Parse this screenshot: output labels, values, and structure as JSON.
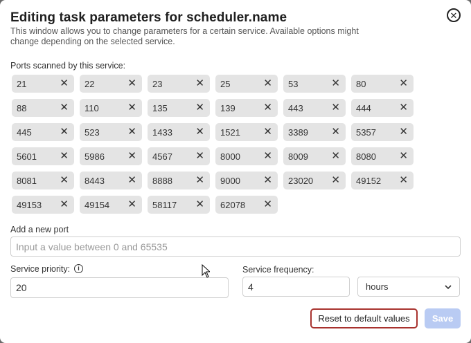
{
  "dialog": {
    "title": "Editing task parameters for scheduler.name",
    "close_icon": "close-circle-icon",
    "subtitle": "This window allows you to change parameters for a certain service. Available options might change depending on the selected service."
  },
  "ports": {
    "label": "Ports scanned by this service:",
    "remove_glyph": "✕",
    "items": [
      "21",
      "22",
      "23",
      "25",
      "53",
      "80",
      "88",
      "110",
      "135",
      "139",
      "443",
      "444",
      "445",
      "523",
      "1433",
      "1521",
      "3389",
      "5357",
      "5601",
      "5986",
      "4567",
      "8000",
      "8009",
      "8080",
      "8081",
      "8443",
      "8888",
      "9000",
      "23020",
      "49152",
      "49153",
      "49154",
      "58117",
      "62078"
    ]
  },
  "new_port": {
    "label": "Add a new port",
    "placeholder": "Input a value between 0 and 65535",
    "value": ""
  },
  "priority": {
    "label": "Service priority:",
    "info_icon": "info-icon",
    "value": "20"
  },
  "frequency": {
    "label": "Service frequency:",
    "value": "4",
    "unit": "hours"
  },
  "buttons": {
    "reset": "Reset to default values",
    "save": "Save"
  },
  "colors": {
    "reset_border": "#a8322e",
    "save_disabled": "#b9cbf3",
    "chip_bg": "#e4e4e4"
  }
}
